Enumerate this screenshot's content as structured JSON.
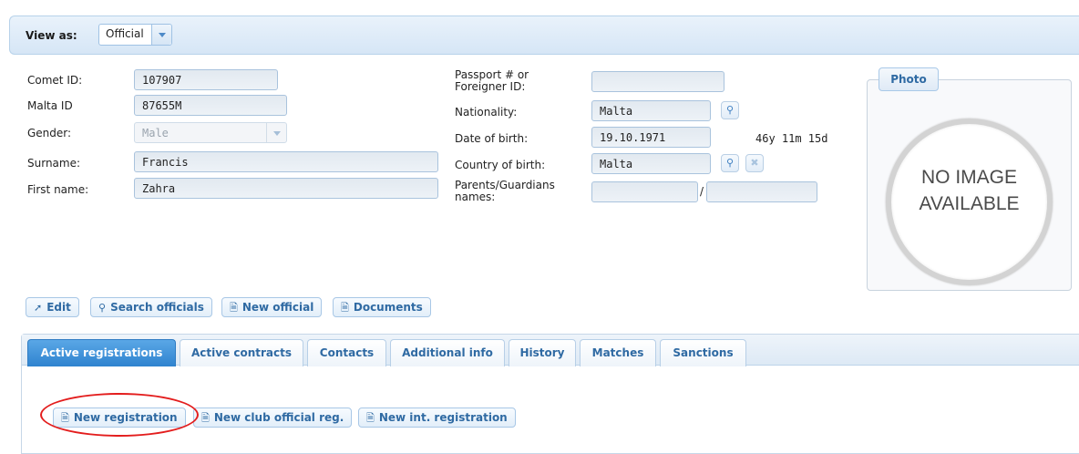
{
  "view_as": {
    "label": "View as:",
    "selected": "Official"
  },
  "form": {
    "comet_id": {
      "label": "Comet ID:",
      "value": "107907"
    },
    "malta_id": {
      "label": "Malta ID",
      "value": "87655M"
    },
    "gender": {
      "label": "Gender:",
      "value": "Male"
    },
    "surname": {
      "label": "Surname:",
      "value": "Francis"
    },
    "first_name": {
      "label": "First name:",
      "value": "Zahra"
    },
    "passport": {
      "label": "Passport # or\nForeigner ID:",
      "value": ""
    },
    "nationality": {
      "label": "Nationality:",
      "value": "Malta"
    },
    "date_of_birth": {
      "label": "Date of birth:",
      "value": "19.10.1971",
      "age": "46y 11m 15d"
    },
    "country_of_birth": {
      "label": "Country of birth:",
      "value": "Malta"
    },
    "parents": {
      "label": "Parents/Guardians\nnames:",
      "value1": "",
      "value2": "",
      "separator": "/"
    }
  },
  "photo": {
    "tab_label": "Photo",
    "placeholder": "NO IMAGE\nAVAILABLE"
  },
  "actions": {
    "edit": "Edit",
    "search": "Search officials",
    "new_official": "New official",
    "documents": "Documents"
  },
  "tabs": [
    {
      "label": "Active registrations",
      "active": true
    },
    {
      "label": "Active contracts",
      "active": false
    },
    {
      "label": "Contacts",
      "active": false
    },
    {
      "label": "Additional info",
      "active": false
    },
    {
      "label": "History",
      "active": false
    },
    {
      "label": "Matches",
      "active": false
    },
    {
      "label": "Sanctions",
      "active": false
    }
  ],
  "tab_actions": {
    "new_registration": "New registration",
    "new_club_official": "New club official reg.",
    "new_int_registration": "New int. registration"
  },
  "icons": {
    "edit": "pencil-icon",
    "search": "magnifier-icon",
    "document": "document-icon",
    "clear": "close-icon",
    "dropdown": "chevron-down-icon"
  },
  "colors": {
    "accent": "#2f6aa3",
    "active_tab": "#3a8ad4",
    "annotation": "#e31d1d"
  }
}
